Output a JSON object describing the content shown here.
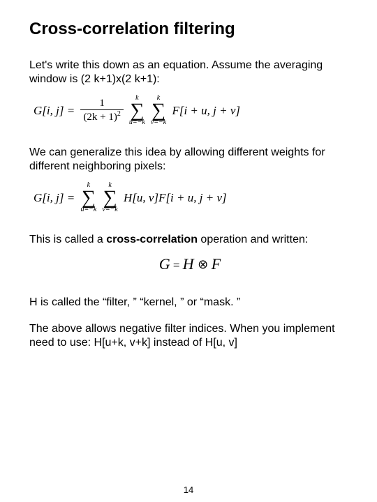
{
  "title": "Cross-correlation filtering",
  "para1": "Let's write this down as an equation.  Assume the averaging window is (2 k+1)x(2 k+1):",
  "eq1": {
    "lhs": "G[i, j] = ",
    "frac_num": "1",
    "frac_den_pre": "(2k + 1)",
    "sum_upper": "k",
    "sum1_lower": "u=−k",
    "sum2_lower": "v=−k",
    "rhs": " F[i + u, j + v]"
  },
  "para2": "We can generalize this idea by allowing different weights for different neighboring pixels:",
  "eq2": {
    "lhs": "G[i, j] = ",
    "sum_upper": "k",
    "sum1_lower": "u=−k",
    "sum2_lower": "v=−k",
    "rhs": " H[u, v]F[i + u, j + v]"
  },
  "para3_pre": "This is called a ",
  "para3_bold": "cross-correlation",
  "para3_post": " operation and written:",
  "eq3": {
    "G": "G",
    "eq": " = ",
    "H": "H",
    "F": "F"
  },
  "para4": "H is called the “filter, ” “kernel, ” or “mask. ”",
  "para5": "The above allows negative filter indices.  When you implement need to use:  H[u+k, v+k] instead of H[u, v]",
  "page_number": "14"
}
